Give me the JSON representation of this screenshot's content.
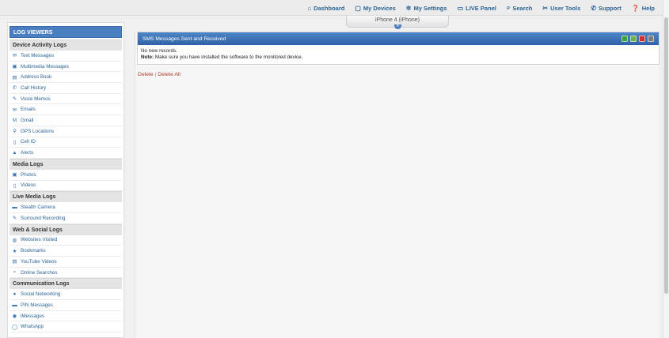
{
  "topnav": {
    "items": [
      {
        "icon": "home-icon",
        "glyph": "⌂",
        "label": "Dashboard"
      },
      {
        "icon": "devices-icon",
        "glyph": "▢",
        "label": "My Devices"
      },
      {
        "icon": "settings-icon",
        "glyph": "✲",
        "label": "My Settings"
      },
      {
        "icon": "live-panel-icon",
        "glyph": "▭",
        "label": "LIVE Panel"
      },
      {
        "icon": "search-icon",
        "glyph": "⌕",
        "label": "Search"
      },
      {
        "icon": "user-tools-icon",
        "glyph": "✂",
        "label": "User Tools"
      },
      {
        "icon": "phone-icon",
        "glyph": "✆",
        "label": "Support"
      },
      {
        "icon": "help-icon",
        "glyph": "❓",
        "label": "Help"
      }
    ]
  },
  "device_selector": {
    "label": "iPhone 4 (iPhone)",
    "chevron": "▾"
  },
  "sidebar": {
    "title": "LOG VIEWERS",
    "sections": [
      {
        "title": "Device Activity Logs",
        "items": [
          {
            "icon": "sms-icon",
            "glyph": "✉",
            "label": "Text Messages"
          },
          {
            "icon": "mms-icon",
            "glyph": "▣",
            "label": "Multimedia Messages"
          },
          {
            "icon": "address-book-icon",
            "glyph": "▤",
            "label": "Address Book"
          },
          {
            "icon": "call-history-icon",
            "glyph": "✆",
            "label": "Call History"
          },
          {
            "icon": "voice-memo-icon",
            "glyph": "✎",
            "label": "Voice Memos"
          },
          {
            "icon": "email-icon",
            "glyph": "✉",
            "label": "Emails"
          },
          {
            "icon": "gmail-icon",
            "glyph": "M",
            "label": "Gmail"
          },
          {
            "icon": "gps-icon",
            "glyph": "⚲",
            "label": "GPS Locations"
          },
          {
            "icon": "cell-id-icon",
            "glyph": "▯",
            "label": "Cell ID"
          },
          {
            "icon": "alert-icon",
            "glyph": "▲",
            "label": "Alerts"
          }
        ]
      },
      {
        "title": "Media Logs",
        "items": [
          {
            "icon": "photos-icon",
            "glyph": "▣",
            "label": "Photos"
          },
          {
            "icon": "videos-icon",
            "glyph": "▯",
            "label": "Videos"
          }
        ]
      },
      {
        "title": "Live Media Logs",
        "items": [
          {
            "icon": "camera-icon",
            "glyph": "▬",
            "label": "Stealth Camera"
          },
          {
            "icon": "microphone-icon",
            "glyph": "✎",
            "label": "Surround Recording"
          }
        ]
      },
      {
        "title": "Web & Social Logs",
        "items": [
          {
            "icon": "globe-icon",
            "glyph": "◍",
            "label": "Websites Visited"
          },
          {
            "icon": "star-icon",
            "glyph": "★",
            "label": "Bookmarks"
          },
          {
            "icon": "youtube-icon",
            "glyph": "▤",
            "label": "YouTube Videos"
          },
          {
            "icon": "search-icon",
            "glyph": "⌕",
            "label": "Online Searches"
          }
        ]
      },
      {
        "title": "Communication Logs",
        "items": [
          {
            "icon": "social-icon",
            "glyph": "●",
            "label": "Social Networking"
          },
          {
            "icon": "pin-icon",
            "glyph": "▬",
            "label": "PIN Messages"
          },
          {
            "icon": "imessage-icon",
            "glyph": "◉",
            "label": "iMessages"
          },
          {
            "icon": "whatsapp-icon",
            "glyph": "◯",
            "label": "WhatsApp"
          }
        ]
      }
    ]
  },
  "panel": {
    "title": "SMS Messages Sent and Received",
    "tools": [
      {
        "icon": "excel-export-icon",
        "color": "#3aa33a"
      },
      {
        "icon": "csv-export-icon",
        "color": "#6fb04a"
      },
      {
        "icon": "pdf-export-icon",
        "color": "#d03030"
      },
      {
        "icon": "print-icon",
        "color": "#7a7a7a"
      }
    ],
    "empty_message": "No new records.",
    "note_label": "Note:",
    "note_text": " Make sure you have installed the software to the monitored device."
  },
  "actions": {
    "delete": "Delete",
    "separator": "|",
    "delete_all": "Delete All"
  },
  "colors": {
    "accent": "#2a6496",
    "header_blue": "#4a7fc1",
    "action_red": "#b03a2e"
  }
}
